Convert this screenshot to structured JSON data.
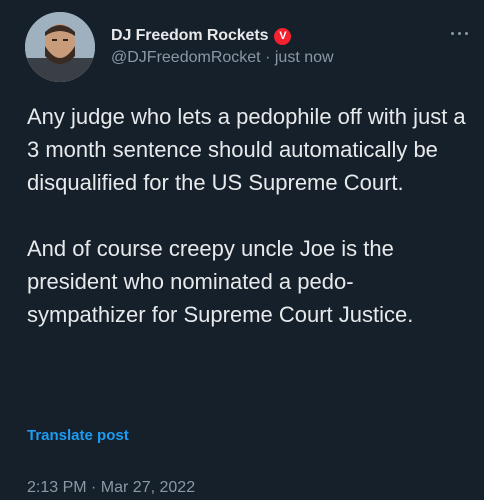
{
  "tweet": {
    "author": {
      "display_name": "DJ Freedom Rockets",
      "badge_icon": "V",
      "handle": "@DJFreedomRocket",
      "separator": "·",
      "relative_time": "just now"
    },
    "text": "Any judge who lets a pedophile off with just a 3 month sentence should automatically be disqualified for the US Supreme Court.\n\nAnd of course creepy uncle Joe is the president who nominated a pedo-sympathizer for Supreme Court Justice.",
    "translate_label": "Translate post",
    "timestamp": "2:13 PM · Mar 27, 2022",
    "colors": {
      "background": "#15202b",
      "text": "#e7e9ea",
      "muted": "#8b98a5",
      "link": "#1d9bf0",
      "badge": "#f4212e"
    },
    "icons": {
      "more": "more-dots-icon"
    }
  }
}
